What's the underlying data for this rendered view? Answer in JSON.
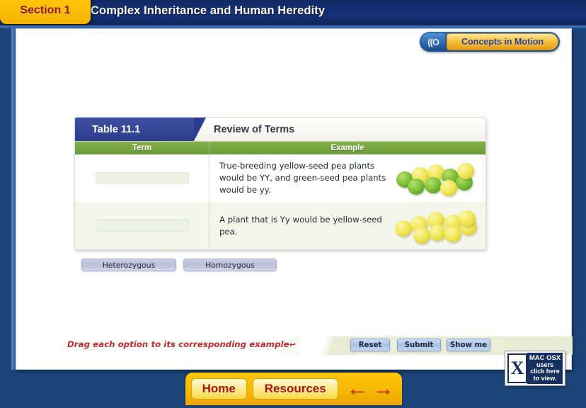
{
  "header": {
    "section_tab": "Section 1",
    "title": "Complex Inheritance and Human Heredity",
    "concepts_button": {
      "icon": "motion-waves-icon",
      "label": "Concepts in Motion"
    }
  },
  "table": {
    "tag": "Table 11.1",
    "subtitle": "Review of Terms",
    "columns": [
      "Term",
      "Example"
    ],
    "rows": [
      {
        "term_value": "",
        "example_text": "True-breeding yellow-seed pea plants would be YY, and green-seed pea plants would be yy.",
        "pea_colors": [
          "green",
          "yellow",
          "yellow",
          "green",
          "green",
          "yellow",
          "green",
          "yellow",
          "green"
        ]
      },
      {
        "term_value": "",
        "example_text": "A plant that is Yy would be yellow-seed pea.",
        "pea_colors": [
          "yellow",
          "yellow",
          "yellow",
          "yellow",
          "yellow",
          "yellow",
          "yellow",
          "yellow",
          "yellow"
        ]
      }
    ]
  },
  "options": [
    {
      "label": "Heterozygous"
    },
    {
      "label": "Homozygous"
    }
  ],
  "controls": {
    "instruction": "Drag each option to its corresponding example",
    "instruction_arrow": "↩",
    "buttons": [
      {
        "label": "Reset"
      },
      {
        "label": "Submit"
      },
      {
        "label": "Show me"
      }
    ]
  },
  "mac_notice": {
    "mark": "X",
    "lines": [
      "MAC OSX",
      "users",
      "click here",
      "to view."
    ]
  },
  "nav": {
    "home": "Home",
    "resources": "Resources",
    "back_arrow": "←",
    "forward_arrow": "→"
  },
  "colors": {
    "frame_navy": "#1b4578",
    "header_navy": "#16317a",
    "accent_gold": "#fdc60b",
    "tag_blue": "#2c3d8e",
    "col_header_green": "#6f9c3b",
    "instruction_red": "#c3292b"
  }
}
